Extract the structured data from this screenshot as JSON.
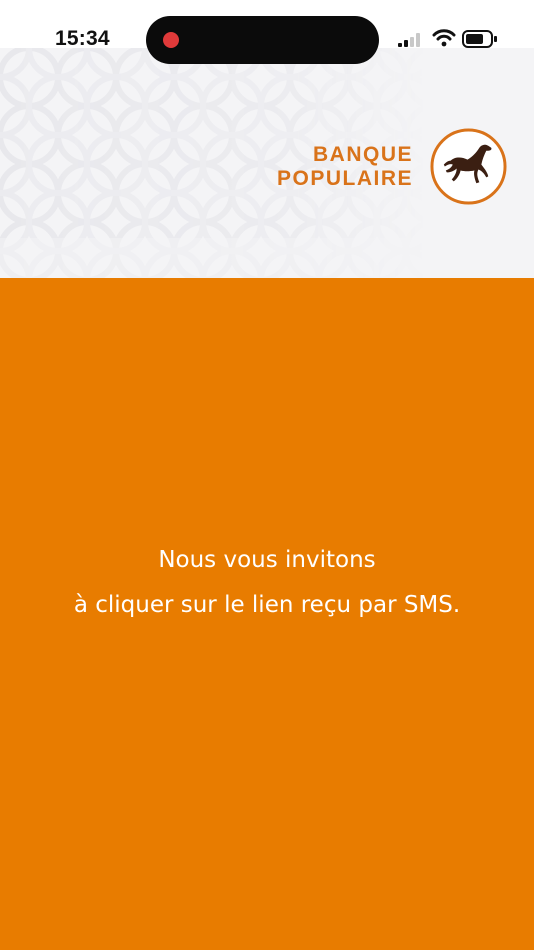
{
  "status_bar": {
    "time": "15:34",
    "icons": [
      "recording-indicator",
      "cellular-signal-icon",
      "wifi-icon",
      "battery-icon"
    ]
  },
  "header": {
    "logo": {
      "line1": "BANQUE",
      "line2": "POPULAIRE",
      "emblem": "horse-emblem",
      "color": "#d9731a"
    }
  },
  "message": {
    "line1": "Nous vous invitons",
    "line2": "à cliquer sur le lien reçu par SMS."
  },
  "colors": {
    "panel_background": "#e87c00",
    "header_background": "#f4f4f6",
    "text_on_panel": "#ffffff"
  }
}
